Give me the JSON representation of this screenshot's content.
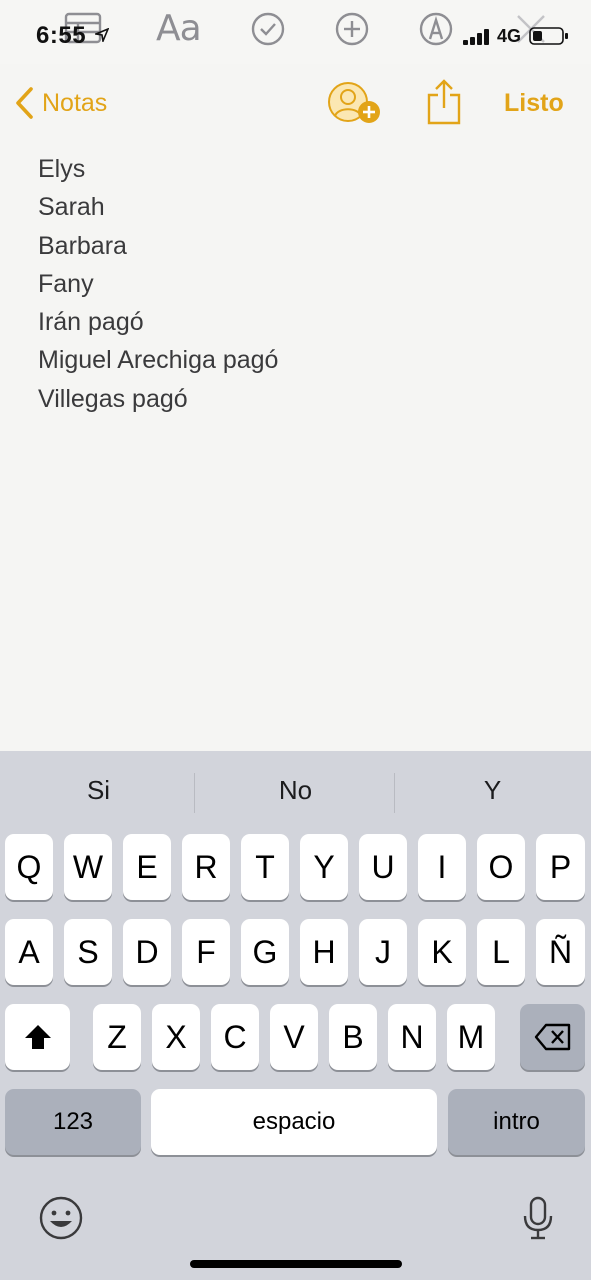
{
  "status_bar": {
    "time": "6:55",
    "network": "4G",
    "icons": [
      "location-arrow-icon",
      "signal-bars-icon",
      "battery-icon"
    ]
  },
  "format_toolbar": {
    "text_style_label": "Aa",
    "icons": [
      "table-icon",
      "text-style-icon",
      "checklist-icon",
      "add-icon",
      "markup-pen-icon",
      "close-icon"
    ]
  },
  "nav": {
    "back_label": "Notas",
    "done_label": "Listo",
    "icons": [
      "chevron-left-icon",
      "add-person-icon",
      "share-icon"
    ],
    "accent_color": "#e2a418"
  },
  "note": {
    "lines": [
      "Elys",
      "Sarah",
      "Barbara",
      "Fany",
      "Irán pagó",
      "Miguel Arechiga pagó",
      "Villegas pagó"
    ]
  },
  "keyboard": {
    "suggestions": [
      "Si",
      "No",
      "Y"
    ],
    "row1": [
      "Q",
      "W",
      "E",
      "R",
      "T",
      "Y",
      "U",
      "I",
      "O",
      "P"
    ],
    "row2": [
      "A",
      "S",
      "D",
      "F",
      "G",
      "H",
      "J",
      "K",
      "L",
      "Ñ"
    ],
    "row3": [
      "Z",
      "X",
      "C",
      "V",
      "B",
      "N",
      "M"
    ],
    "numbers_label": "123",
    "space_label": "espacio",
    "return_label": "intro",
    "icons": [
      "shift-icon",
      "delete-icon",
      "emoji-icon",
      "microphone-icon"
    ]
  }
}
